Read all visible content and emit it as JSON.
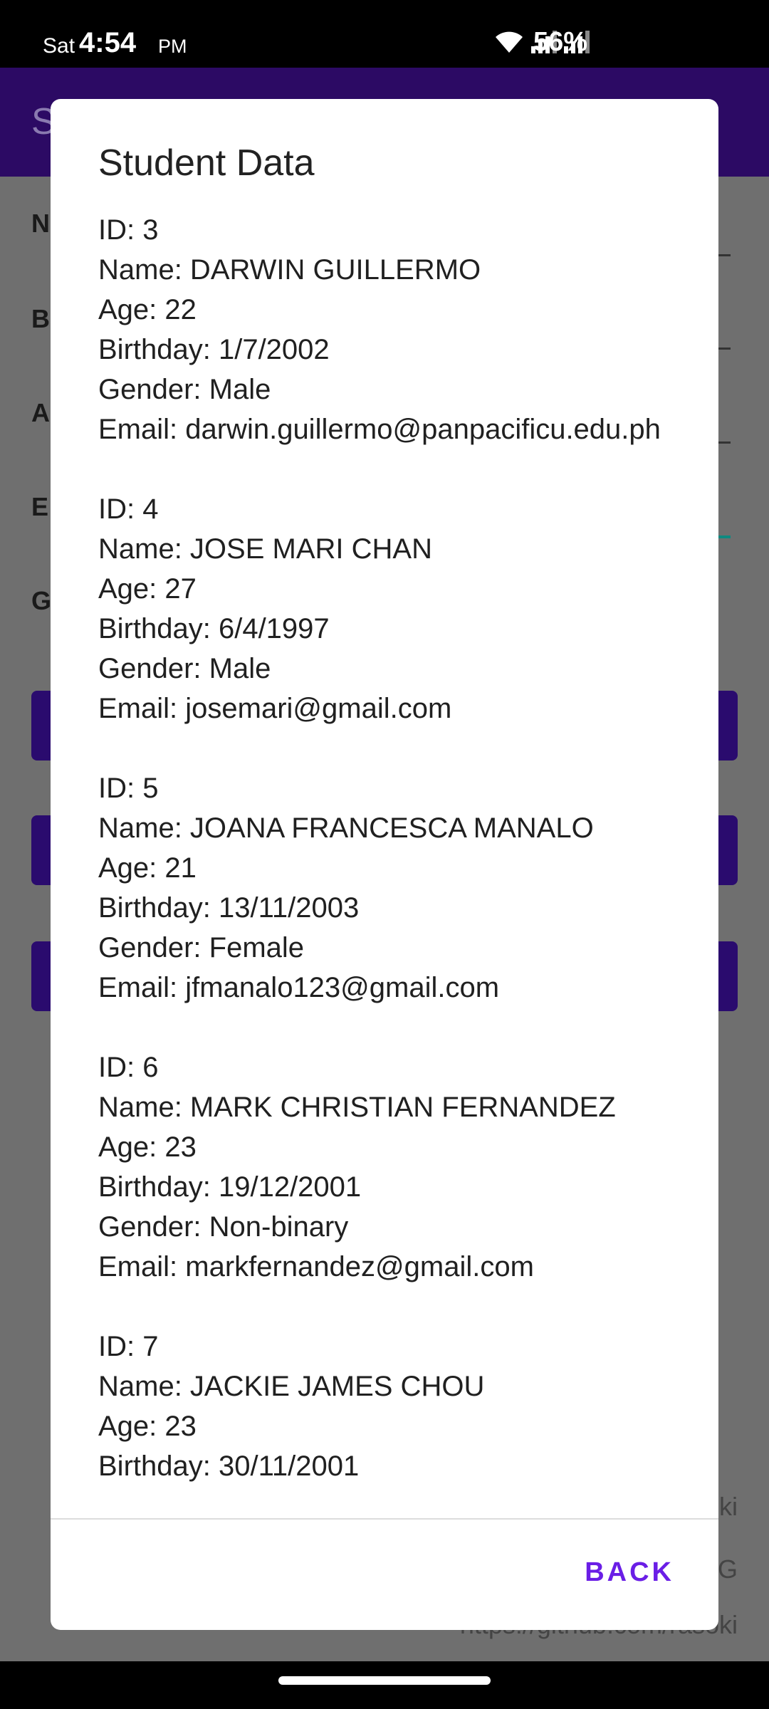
{
  "status_bar": {
    "day": "Sat",
    "time": "4:54",
    "ampm": "PM",
    "battery": "56%"
  },
  "background_app": {
    "title_initial": "S",
    "field_initials": [
      "N",
      "B",
      "A",
      "E",
      "G"
    ],
    "footer_lines": [
      "ki",
      "G",
      "https://github.com/rasoki"
    ]
  },
  "dialog": {
    "title": "Student Data",
    "records": [
      {
        "id": "ID: 3",
        "name": "Name: DARWIN GUILLERMO",
        "age": "Age: 22",
        "birthday": "Birthday: 1/7/2002",
        "gender": "Gender: Male",
        "email": "Email: darwin.guillermo@panpacificu.edu.ph"
      },
      {
        "id": "ID: 4",
        "name": "Name: JOSE MARI CHAN",
        "age": "Age: 27",
        "birthday": "Birthday: 6/4/1997",
        "gender": "Gender: Male",
        "email": "Email: josemari@gmail.com"
      },
      {
        "id": "ID: 5",
        "name": "Name: JOANA FRANCESCA MANALO",
        "age": "Age: 21",
        "birthday": "Birthday: 13/11/2003",
        "gender": "Gender: Female",
        "email": "Email: jfmanalo123@gmail.com"
      },
      {
        "id": "ID: 6",
        "name": "Name: MARK CHRISTIAN FERNANDEZ",
        "age": "Age: 23",
        "birthday": "Birthday: 19/12/2001",
        "gender": "Gender: Non-binary",
        "email": "Email: markfernandez@gmail.com"
      },
      {
        "id": "ID: 7",
        "name": "Name: JACKIE JAMES CHOU",
        "age": "Age: 23",
        "birthday": "Birthday: 30/11/2001",
        "gender": "",
        "email": ""
      }
    ],
    "back_label": "BACK"
  },
  "colors": {
    "accent": "#6a1ee6",
    "appbar": "#2c0a64",
    "scrim": "#6f6f6f"
  }
}
